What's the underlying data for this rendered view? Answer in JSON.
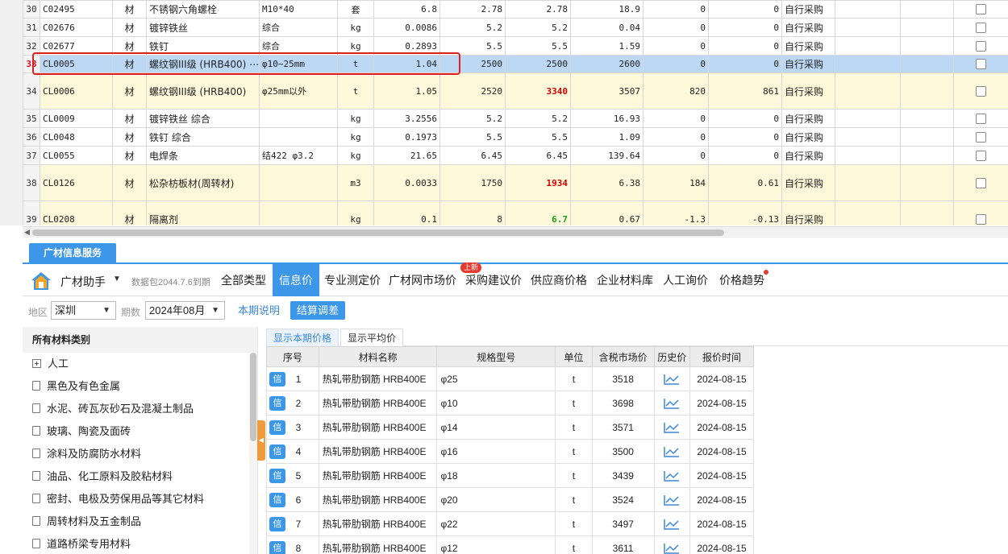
{
  "grid": {
    "rows": [
      {
        "no": "30",
        "code": "C02495",
        "cls": "材",
        "name": "不锈钢六角螺栓",
        "spec": "M10*40",
        "unit": "套",
        "qty": "6.8",
        "p1": "2.78",
        "p2": "2.78",
        "amt": "18.9",
        "d1": "0",
        "d2": "0",
        "src": "自行采购",
        "style": "normal"
      },
      {
        "no": "31",
        "code": "C02676",
        "cls": "材",
        "name": "镀锌铁丝",
        "spec": "综合",
        "unit": "kg",
        "qty": "0.0086",
        "p1": "5.2",
        "p2": "5.2",
        "amt": "0.04",
        "d1": "0",
        "d2": "0",
        "src": "自行采购",
        "style": "normal"
      },
      {
        "no": "32",
        "code": "C02677",
        "cls": "材",
        "name": "铁钉",
        "spec": "综合",
        "unit": "kg",
        "qty": "0.2893",
        "p1": "5.5",
        "p2": "5.5",
        "amt": "1.59",
        "d1": "0",
        "d2": "0",
        "src": "自行采购",
        "style": "normal"
      },
      {
        "no": "33",
        "code": "CL0005",
        "cls": "材",
        "name": "螺纹钢III级 (HRB400)",
        "spec": "φ10~25mm",
        "unit": "t",
        "qty": "1.04",
        "p1": "2500",
        "p2": "2500",
        "amt": "2600",
        "d1": "0",
        "d2": "0",
        "src": "自行采购",
        "style": "sel"
      },
      {
        "no": "34",
        "code": "CL0006",
        "cls": "材",
        "name": "螺纹钢III级 (HRB400)",
        "spec": "φ25mm以外",
        "unit": "t",
        "qty": "1.05",
        "p1": "2520",
        "p2": "3340",
        "amt": "3507",
        "d1": "820",
        "d2": "861",
        "src": "自行采购",
        "style": "hl",
        "p2c": "red"
      },
      {
        "no": "35",
        "code": "CL0009",
        "cls": "材",
        "name": "镀锌铁丝 综合",
        "spec": "",
        "unit": "kg",
        "qty": "3.2556",
        "p1": "5.2",
        "p2": "5.2",
        "amt": "16.93",
        "d1": "0",
        "d2": "0",
        "src": "自行采购",
        "style": "normal"
      },
      {
        "no": "36",
        "code": "CL0048",
        "cls": "材",
        "name": "铁钉 综合",
        "spec": "",
        "unit": "kg",
        "qty": "0.1973",
        "p1": "5.5",
        "p2": "5.5",
        "amt": "1.09",
        "d1": "0",
        "d2": "0",
        "src": "自行采购",
        "style": "normal"
      },
      {
        "no": "37",
        "code": "CL0055",
        "cls": "材",
        "name": "电焊条",
        "spec": "结422 φ3.2",
        "unit": "kg",
        "qty": "21.65",
        "p1": "6.45",
        "p2": "6.45",
        "amt": "139.64",
        "d1": "0",
        "d2": "0",
        "src": "自行采购",
        "style": "normal"
      },
      {
        "no": "38",
        "code": "CL0126",
        "cls": "材",
        "name": "松杂枋板材(周转材)",
        "spec": "",
        "unit": "m3",
        "qty": "0.0033",
        "p1": "1750",
        "p2": "1934",
        "amt": "6.38",
        "d1": "184",
        "d2": "0.61",
        "src": "自行采购",
        "style": "hl",
        "p2c": "red"
      },
      {
        "no": "39",
        "code": "CL0208",
        "cls": "材",
        "name": "隔离剂",
        "spec": "",
        "unit": "kg",
        "qty": "0.1",
        "p1": "8",
        "p2": "6.7",
        "amt": "0.67",
        "d1": "-1.3",
        "d2": "-0.13",
        "src": "自行采购",
        "style": "hl",
        "p2c": "green"
      }
    ]
  },
  "panel": {
    "service_tab": "广材信息服务",
    "assistant": "广材助手",
    "expiry": "数据包2044.7.6到期",
    "tabs": [
      "全部类型",
      "信息价",
      "专业测定价",
      "广材网市场价",
      "采购建议价",
      "供应商价格",
      "企业材料库",
      "人工询价",
      "价格趋势"
    ],
    "active_tab": "信息价",
    "new_badge": "上新",
    "region_label": "地区",
    "region": "深圳",
    "period_label": "期数",
    "period": "2024年08月",
    "period_note": "本期说明",
    "settle_btn": "结算调差"
  },
  "categories": {
    "header": "所有材料类别",
    "items": [
      "人工",
      "黑色及有色金属",
      "水泥、砖瓦灰砂石及混凝土制品",
      "玻璃、陶瓷及面砖",
      "涂料及防腐防水材料",
      "油品、化工原料及胶粘材料",
      "密封、电极及劳保用品等其它材料",
      "周转材料及五金制品",
      "道路桥梁专用材料"
    ]
  },
  "price_view": {
    "tabs": [
      "显示本期价格",
      "显示平均价"
    ],
    "columns": [
      "序号",
      "材料名称",
      "规格型号",
      "单位",
      "含税市场价",
      "历史价",
      "报价时间"
    ],
    "tag": "信",
    "rows": [
      {
        "seq": "1",
        "name": "热轧带肋钢筋 HRB400E",
        "spec": "φ25",
        "unit": "t",
        "price": "3518",
        "date": "2024-08-15"
      },
      {
        "seq": "2",
        "name": "热轧带肋钢筋 HRB400E",
        "spec": "φ10",
        "unit": "t",
        "price": "3698",
        "date": "2024-08-15"
      },
      {
        "seq": "3",
        "name": "热轧带肋钢筋 HRB400E",
        "spec": "φ14",
        "unit": "t",
        "price": "3571",
        "date": "2024-08-15"
      },
      {
        "seq": "4",
        "name": "热轧带肋钢筋 HRB400E",
        "spec": "φ16",
        "unit": "t",
        "price": "3500",
        "date": "2024-08-15"
      },
      {
        "seq": "5",
        "name": "热轧带肋钢筋 HRB400E",
        "spec": "φ18",
        "unit": "t",
        "price": "3439",
        "date": "2024-08-15"
      },
      {
        "seq": "6",
        "name": "热轧带肋钢筋 HRB400E",
        "spec": "φ20",
        "unit": "t",
        "price": "3524",
        "date": "2024-08-15"
      },
      {
        "seq": "7",
        "name": "热轧带肋钢筋 HRB400E",
        "spec": "φ22",
        "unit": "t",
        "price": "3497",
        "date": "2024-08-15"
      },
      {
        "seq": "8",
        "name": "热轧带肋钢筋 HRB400E",
        "spec": "φ12",
        "unit": "t",
        "price": "3611",
        "date": "2024-08-15"
      }
    ]
  }
}
